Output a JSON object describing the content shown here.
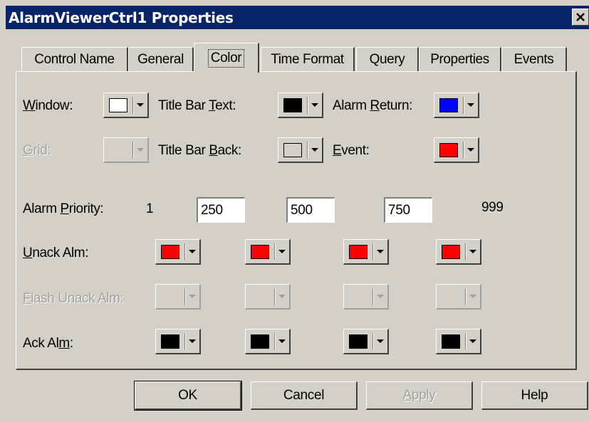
{
  "window": {
    "title": "AlarmViewerCtrl1 Properties"
  },
  "tabs": [
    {
      "label": "Control Name",
      "active": false
    },
    {
      "label": "General",
      "active": false
    },
    {
      "label": "Color",
      "active": true
    },
    {
      "label": "Time Format",
      "active": false
    },
    {
      "label": "Query",
      "active": false
    },
    {
      "label": "Properties",
      "active": false
    },
    {
      "label": "Events",
      "active": false
    }
  ],
  "color_tab": {
    "window_label": {
      "pre": "",
      "key": "W",
      "post": "indow:"
    },
    "window_color": "#ffffff",
    "title_bar_text_label": {
      "pre": "Title Bar ",
      "key": "T",
      "post": "ext:"
    },
    "title_bar_text_color": "#000000",
    "alarm_return_label": {
      "pre": "Alarm ",
      "key": "R",
      "post": "eturn:"
    },
    "alarm_return_color": "#0000ff",
    "grid_label": {
      "pre": "",
      "key": "G",
      "post": "rid:"
    },
    "title_bar_back_label": {
      "pre": "Title Bar ",
      "key": "B",
      "post": "ack:"
    },
    "title_bar_back_color": "#d4d0c8",
    "event_label": {
      "pre": "",
      "key": "E",
      "post": "vent:"
    },
    "event_color": "#ff0000",
    "alarm_priority_label": {
      "pre": "Alarm ",
      "key": "P",
      "post": "riority:"
    },
    "priority_start": "1",
    "priority_values": [
      "250",
      "500",
      "750"
    ],
    "priority_end": "999",
    "unack_alm_label": {
      "pre": "",
      "key": "U",
      "post": "nack Alm:"
    },
    "unack_colors": [
      "#ff0000",
      "#ff0000",
      "#ff0000",
      "#ff0000"
    ],
    "flash_unack_alm_label": {
      "pre": "",
      "key": "F",
      "post": "lash Unack Alm:"
    },
    "ack_alm_label": {
      "pre": "Ack Al",
      "key": "m",
      "post": ":"
    },
    "ack_colors": [
      "#000000",
      "#000000",
      "#000000",
      "#000000"
    ]
  },
  "buttons": {
    "ok": "OK",
    "cancel": "Cancel",
    "apply": {
      "pre": "",
      "key": "A",
      "post": "pply"
    },
    "help": "Help"
  },
  "icons": {
    "close": "close-icon",
    "dropdown": "chevron-down-icon"
  }
}
